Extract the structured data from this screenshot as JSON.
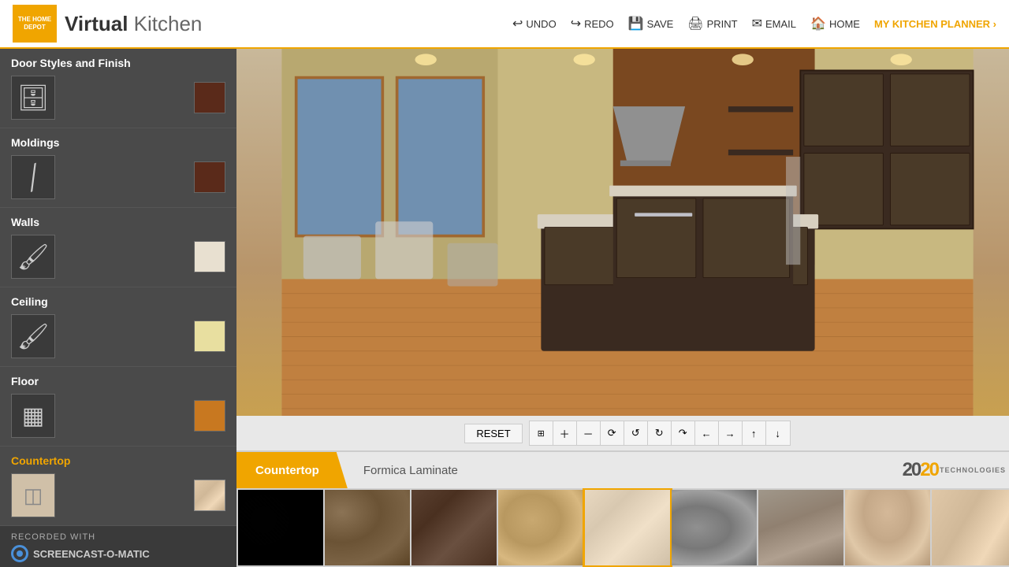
{
  "header": {
    "logo_text": "THE HOME DEPOT",
    "app_title_bold": "Virtual",
    "app_title_light": "Kitchen",
    "nav_items": [
      {
        "label": "UNDO",
        "icon": "↩"
      },
      {
        "label": "REDO",
        "icon": "↪"
      },
      {
        "label": "SAVE",
        "icon": "💾"
      },
      {
        "label": "PRINT",
        "icon": "🖨"
      },
      {
        "label": "EMAIL",
        "icon": "✉"
      },
      {
        "label": "HOME",
        "icon": "🏠"
      }
    ],
    "kitchen_planner_label": "MY KITCHEN PLANNER ›"
  },
  "sidebar": {
    "sections": [
      {
        "id": "door-styles",
        "title": "Door Styles and Finish",
        "icon": "cabinet",
        "swatch_color": "#5a2a1a"
      },
      {
        "id": "moldings",
        "title": "Moldings",
        "icon": "molding",
        "swatch_color": "#5a2a1a"
      },
      {
        "id": "walls",
        "title": "Walls",
        "icon": "brush",
        "swatch_color": "#e8e0d0"
      },
      {
        "id": "ceiling",
        "title": "Ceiling",
        "icon": "brush",
        "swatch_color": "#e8dfa0"
      },
      {
        "id": "floor",
        "title": "Floor",
        "icon": "floor",
        "swatch_color": "#c87820"
      }
    ],
    "countertop_label": "Countertop",
    "countertop_swatch": "#d4b898",
    "screencast_label": "RECORDED WITH",
    "screencast_brand": "SCREENCAST-O-MATIC"
  },
  "toolbar": {
    "reset_label": "RESET",
    "zoom_in": "+",
    "zoom_out": "−",
    "rotate_3d": "⟳",
    "rotate_ccw": "↺",
    "rotate_cw": "↻",
    "rotate_r": "↷",
    "arrow_left": "←",
    "arrow_right": "→",
    "arrow_up": "↑",
    "arrow_down": "↓"
  },
  "bottom": {
    "tab_label": "Countertop",
    "material_label": "Formica Laminate",
    "logo_2020": "20 20",
    "technologies": "TECHNOLOGIES"
  },
  "swatches": [
    {
      "id": "sw1",
      "style_class": "swatch-dark-granite",
      "selected": false
    },
    {
      "id": "sw2",
      "style_class": "swatch-brown-speckle",
      "selected": false
    },
    {
      "id": "sw3",
      "style_class": "swatch-dark-brown",
      "selected": false
    },
    {
      "id": "sw4",
      "style_class": "swatch-sandy-granite",
      "selected": false
    },
    {
      "id": "sw5",
      "style_class": "swatch-light-beige",
      "selected": true
    },
    {
      "id": "sw6",
      "style_class": "swatch-gray-speckle",
      "selected": false
    },
    {
      "id": "sw7",
      "style_class": "swatch-medium-gray",
      "selected": false
    },
    {
      "id": "sw8",
      "style_class": "swatch-tan-speckle",
      "selected": false
    },
    {
      "id": "sw9",
      "style_class": "swatch-light-tan",
      "selected": false
    }
  ]
}
